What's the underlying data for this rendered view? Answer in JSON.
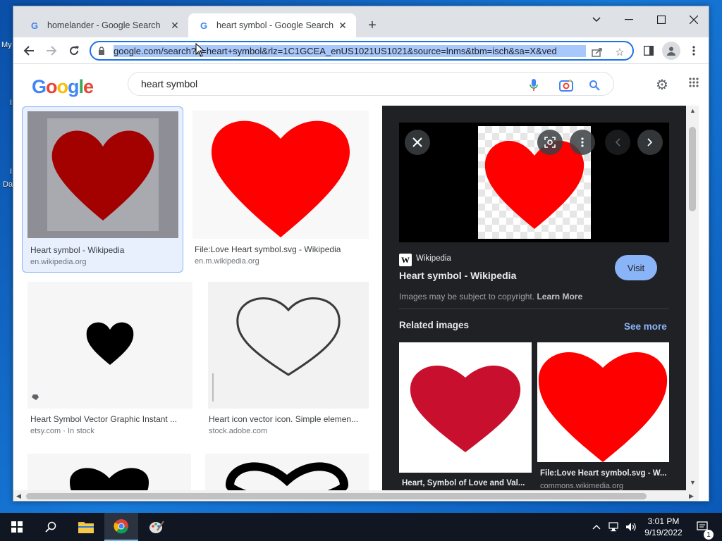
{
  "desktop": {
    "labels": [
      "My",
      "I",
      "I",
      "Da"
    ]
  },
  "browser": {
    "tabs": [
      {
        "title": "homelander - Google Search",
        "favicon": "G"
      },
      {
        "title": "heart symbol - Google Search",
        "favicon": "G"
      }
    ],
    "url": "google.com/search?q=heart+symbol&rlz=1C1GCEA_enUS1021US1021&source=lnms&tbm=isch&sa=X&ved"
  },
  "google": {
    "logo": "Google",
    "query": "heart symbol"
  },
  "results": [
    {
      "title": "Heart symbol - Wikipedia",
      "source": "en.wikipedia.org"
    },
    {
      "title": "File:Love Heart symbol.svg - Wikipedia",
      "source": "en.m.wikipedia.org"
    },
    {
      "title": "Heart Symbol Vector Graphic Instant ...",
      "source": "etsy.com · In stock"
    },
    {
      "title": "Heart icon vector icon. Simple elemen...",
      "source": "stock.adobe.com"
    }
  ],
  "panel": {
    "site": "Wikipedia",
    "site_initial": "W",
    "title": "Heart symbol - Wikipedia",
    "visit_label": "Visit",
    "copyright": "Images may be subject to copyright.",
    "learn_more": "Learn More",
    "related_heading": "Related images",
    "see_more": "See more",
    "related": [
      {
        "title": "Heart, Symbol of Love and Val...",
        "source": ""
      },
      {
        "title": "File:Love Heart symbol.svg - W...",
        "source": "commons.wikimedia.org"
      }
    ]
  },
  "taskbar": {
    "time": "3:01 PM",
    "date": "9/19/2022",
    "notification_count": "1"
  },
  "colors": {
    "red_heart": "#ff0000",
    "dark_red_heart": "#a30000",
    "crimson_heart": "#c8102e",
    "accent_blue": "#1a73e8",
    "panel_bg": "#202124"
  }
}
